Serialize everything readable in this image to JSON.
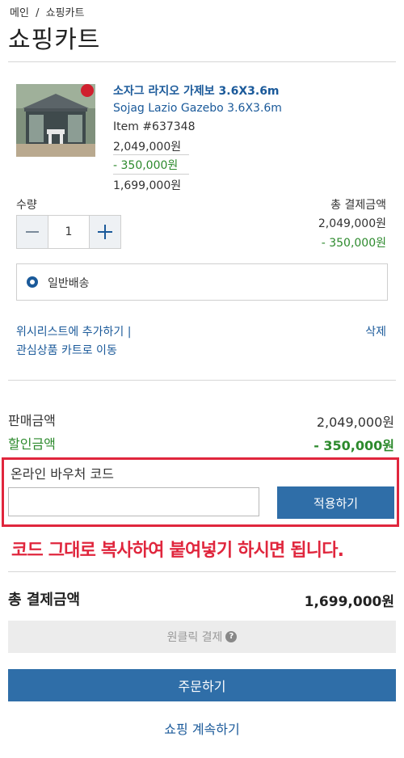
{
  "breadcrumb": {
    "home": "메인",
    "separator": "/",
    "current": "쇼핑카트"
  },
  "page_title": "쇼핑카트",
  "product": {
    "name_ko": "소자그 라지오 가제보 3.6X3.6m",
    "name_en": "Sojag Lazio Gazebo 3.6X3.6m",
    "item_no": "Item #637348",
    "price": "2,049,000원",
    "discount": "- 350,000원",
    "final_price": "1,699,000원",
    "badge_colors": {
      "badge": "#d0202e"
    }
  },
  "quantity": {
    "label": "수량",
    "value": "1",
    "minus_icon": "minus-icon",
    "plus_icon": "plus-icon"
  },
  "line_total": {
    "label": "총 결제금액",
    "price": "2,049,000원",
    "discount": "- 350,000원"
  },
  "shipping": {
    "label": "일반배송"
  },
  "actions": {
    "wishlist": "위시리스트에 추가하기 |",
    "move_to_interest": "관심상품 카트로 이동",
    "delete": "삭제"
  },
  "summary": {
    "sale_label": "판매금액",
    "sale_value": "2,049,000원",
    "discount_label": "할인금액",
    "discount_value": "- 350,000원"
  },
  "voucher": {
    "title": "온라인 바우처 코드",
    "input_value": "",
    "apply_label": "적용하기"
  },
  "notice": "코드 그대로 복사하여 붙여넣기 하시면 됩니다.",
  "total": {
    "label": "총 결제금액",
    "value": "1,699,000원"
  },
  "oneclick": {
    "label": "원클릭 결제",
    "help": "?"
  },
  "order_label": "주문하기",
  "continue_label": "쇼핑 계속하기",
  "colors": {
    "accent": "#2f6ea8",
    "link": "#1b5a9a",
    "discount": "#2d8a2d",
    "alert": "#e0263d"
  }
}
